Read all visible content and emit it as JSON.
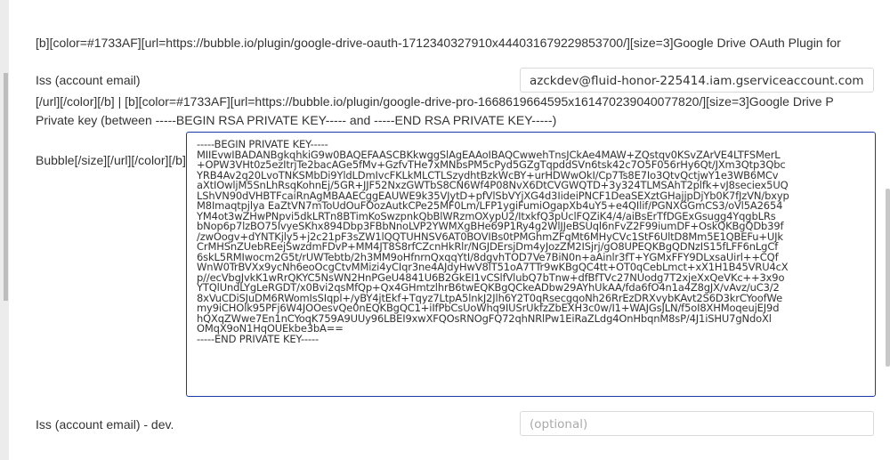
{
  "description": {
    "lines": [
      "[b][color=#1733AF][url=https://bubble.io/plugin/google-drive-oauth-1712340327910x444031679229853700/][size=3]Google Drive OAuth Plugin for",
      "[/url][/color][/b] | [b][color=#1733AF][url=https://bubble.io/plugin/google-drive-pro-1668619664595x161470239040077820/][size=3]Google Drive P",
      "Bubble[/size][/url][/color][/b]"
    ]
  },
  "fields": {
    "iss": {
      "label": "Iss (account email)",
      "value": "azckdev@fluid-honor-225414.iam.gserviceaccount.com"
    },
    "private_key": {
      "label": "Private key (between -----BEGIN RSA PRIVATE KEY----- and -----END RSA PRIVATE KEY-----)",
      "value": "-----BEGIN PRIVATE KEY-----\nMIIEvwIBADANBgkqhkiG9w0BAQEFAASCBKkwggSlAgEAAoIBAQCwwehTnsJCkAe4MAW+ZQstqv0KSvZArVE4LTFSMerL\n+OPW3VHt0z5ezItrjTe2bacAGe5fMv+GzfvTHe7xMNbsPM5cPyd5GZgTqpddSVn6tsk42c7O5F056rHy6Qt/JXm3Qtp3Qbc\nYRB4Av2q20LvoTNKSMbDi9YldLDmIvcFKLkMLCTLSzydhtBzkWcBY+urHDWwOkI/Cp7Ts8E7Io3QtvQctjwY1e3WB6MCv\naXtIOwljM5SnLhRsqKohnEj/5GR+JJF52NxzGWTbS8CN6Wf4P08NvX6DtCVGWQTD+3y324TLMSAhT2plfk+vJ8seciex5UQ\nLShVN90dVHBTFcaiRnAgMBAAECggEAUWE9k35VJytD+pfVlSbVYjXG4d3IideiPNCF1DeaSEXztGHajjpDjYb0K7fJzVN/bxyp\nM8Imaqtpjlya EaZtVN7mToUdOuFOozAutkCPe25MF0Lm/LFP1ygiFumiOgapXb4uY5+e4QIlif/PGNXGGmCS3/oVl5A2654\nYM4ot3wZHwPNpvi5dkLRTn8BTimKoSwzpnkQbBlWRzmOXypU2/ItxkfQ3pUclFQZiK4/4/aiBsErTfDGExGsugg4YqgbLRs\nbNop6p7lzBO75lvyeSKhx894Dbp3FBbNnoLVP2YWMXgBHe69P1Ry4g2WlJJeBSUql6nFvZ2F99iumDF+OskQKBgQDb39f\n/zwOogv+dYNTKjly5+j2c21pF3sZW1lQQTUHNSV6AT0BOVIBs0tPMGhmZFqMt6MHyCVc1StF6UltD8Mm5E1QBEFu+UJk\nCrMHSnZUebREejSwzdmFDvP+MM4JT8S8rfCZcnHkRlr/NGJDErsjDm4yJozZM2ISjrj/gO8UPEQKBgQDNzIS15fLFF6nLgCf\n6skL5RMIwocm2G5t/rUWTebtb/2h3MM9oHfnrnQxqqYtI/8dgvhTOD7Ve7BiN0n+aAinlr3fT+YGMxFFY9DLxsaUirl++CQf\nWnW0TrBVXx9ycNh6eoOcgCtvMMizi4yCIqr3ne4AJdyHwV8lT51oA7TTr9wKBgQC4tt+OT0qCebLmct+xX1H1B45VRU4cX\np//ecVbgJvkK1wRrQKYC5NsWN2HnPGeU4841U6B2GkEI1vCSlfVlubQ7bTnw+dfBfTVc27NUodg7T2xjeXxQeVKc++3x9o\nYTQlUndLYgLeRGDT/x0Bvi2qsMfQp+Qx4GHmtzlhrB6twEQKBgQCkeADbw29AYhUkAA/fda6fO4n1a4Z8gJX/vAvz/uC3/2\n8xVuCDiSJuDM6RWomIsSIqpl+/yBY4jtEkf+Tqyz7LtpA5lnkJ2Jlh6Y2T0qRsecgqoNh26RrEzDRXvybKAvt2S6D3krCYoofWe\nmy9iCHOlk95PFj6W4JOOesvQe0nEQKBgQC1+iIfPbCsUoWhq9IUSrUkfzZbEXH3c0w/I1+WAJGsJLN/f5oI8XHMoqeujEJ9d\nhQXqZWwe7En1nCYoqK759A9UUy96LBEI9xwXFQOsRNOgFQ72qhNRlPw1EiRaZLdg4OnHbqnM8sP/4J1iSHU7gNdoXl\nOMqX9oN1HqOUEkbe3bA==\n-----END PRIVATE KEY-----"
    },
    "iss_dev": {
      "label": "Iss (account email) - dev.",
      "placeholder": "(optional)"
    }
  }
}
